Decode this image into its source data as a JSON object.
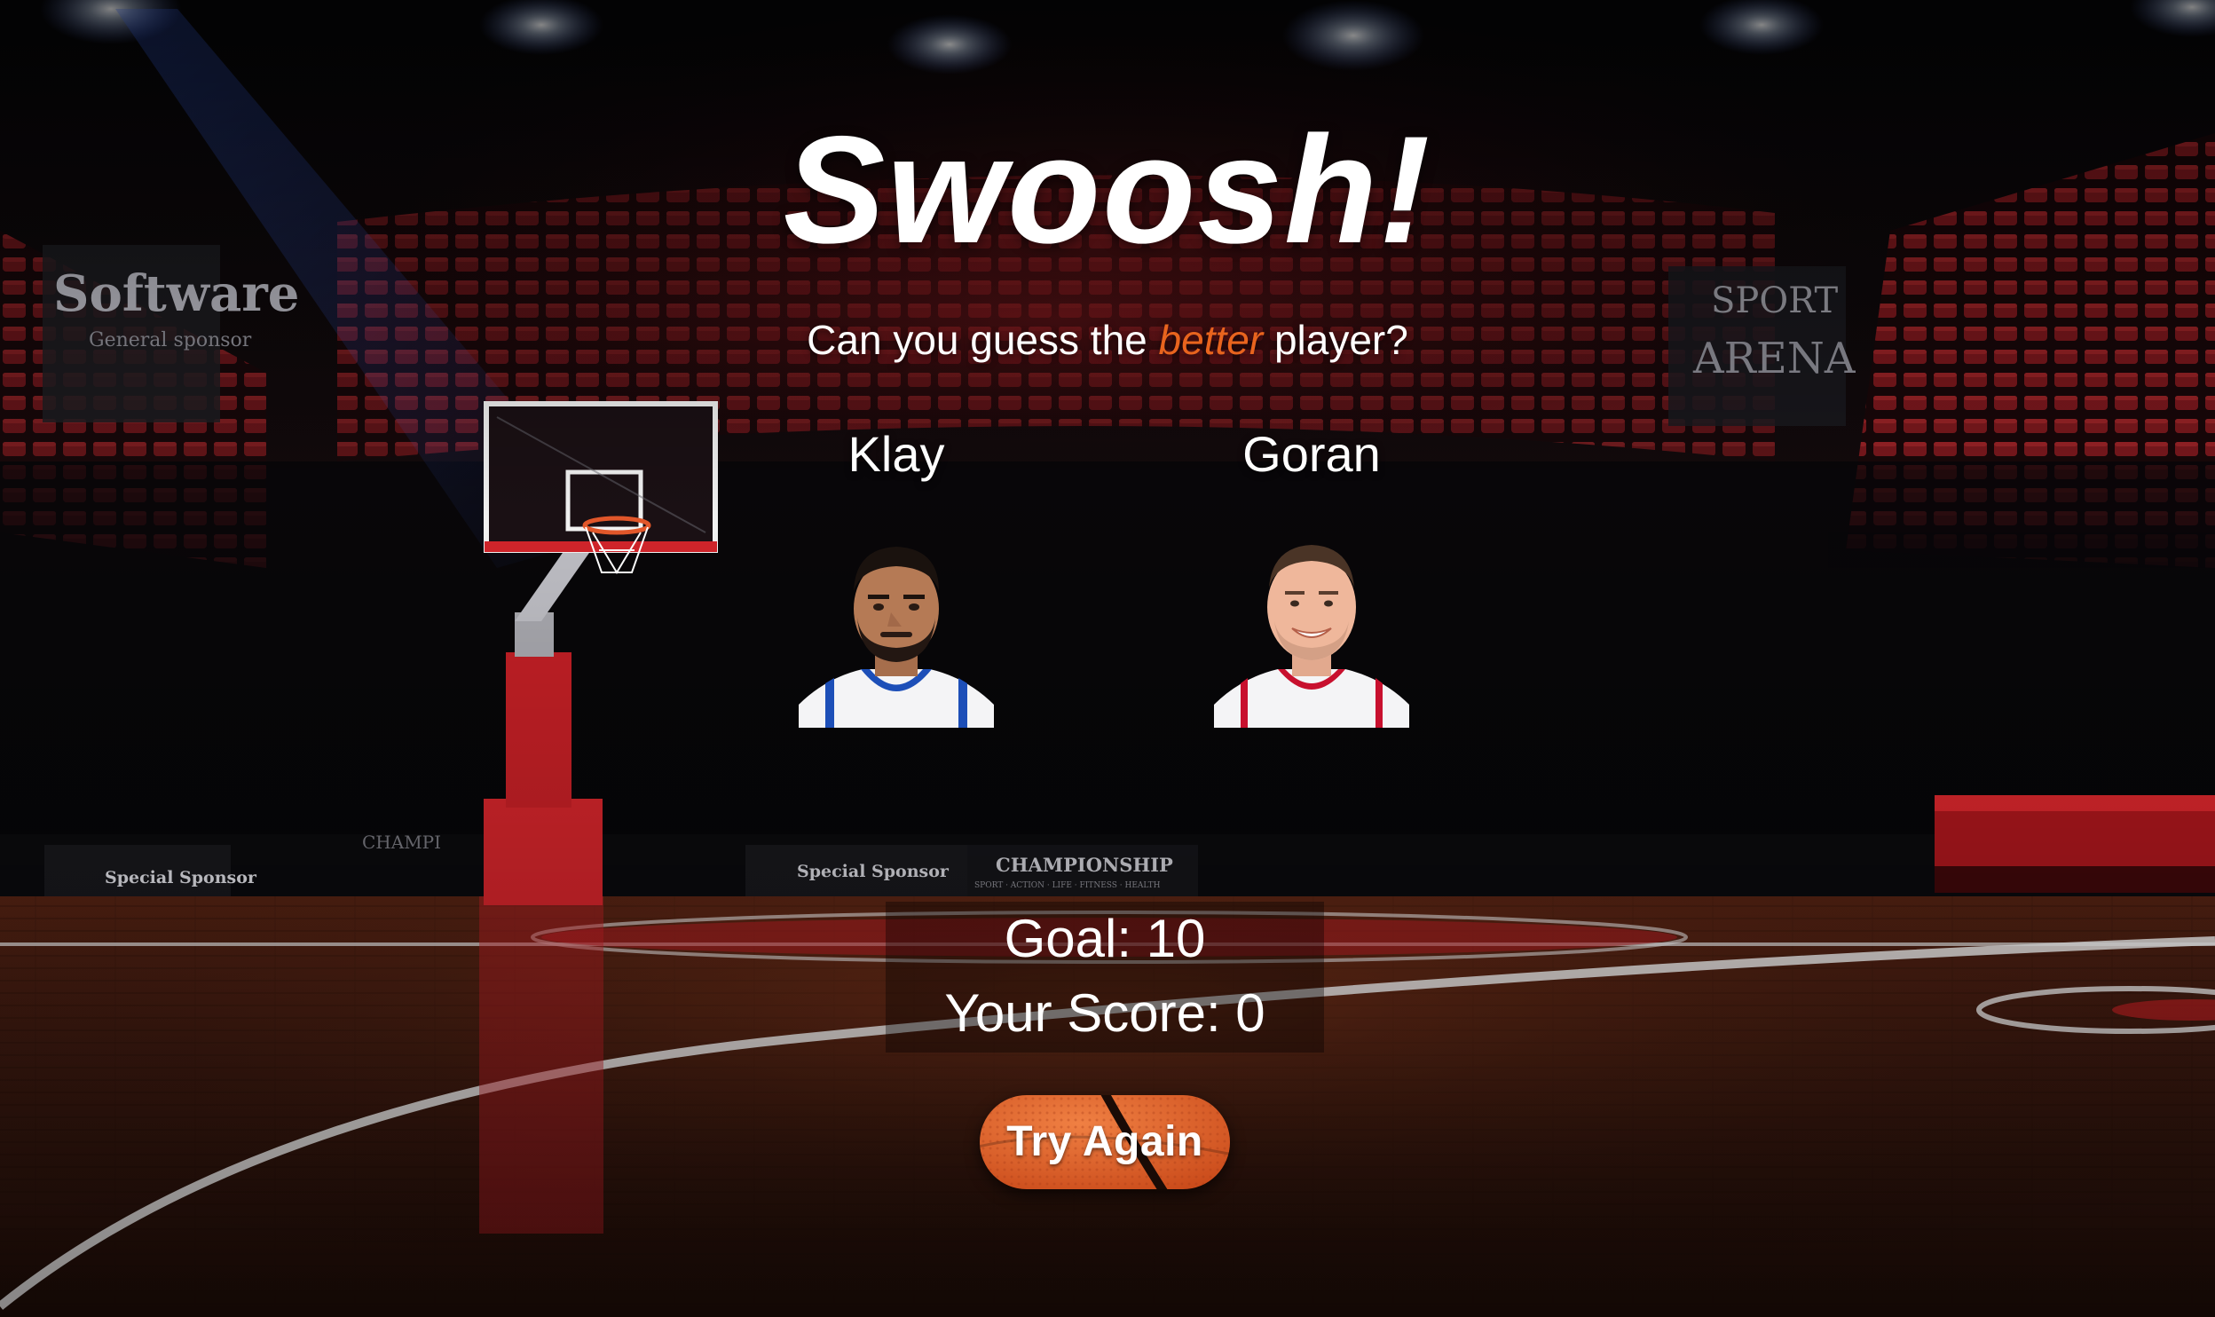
{
  "game": {
    "title": "Swoosh!",
    "subtitle_pre": "Can you guess the ",
    "subtitle_accent": "better",
    "subtitle_post": " player?",
    "accent_color": "#e8641e"
  },
  "players": [
    {
      "name": "Klay",
      "jersey_color": "#1d4fb8"
    },
    {
      "name": "Goran",
      "jersey_color": "#c8102e"
    }
  ],
  "score": {
    "goal_text": "Goal: 10",
    "score_text": "Your Score: 0"
  },
  "actions": {
    "try_again_label": "Try Again",
    "button_color": "#e2571f"
  },
  "background": {
    "signs": [
      "Software",
      "General sponsor",
      "SPORT",
      "ARENA",
      "Special Sponsor",
      "Special Sponsor",
      "CHAMPIONSHIP",
      "SPORT · ACTION · LIFE · FITNESS · HEALTH",
      "CHAMPI"
    ]
  }
}
